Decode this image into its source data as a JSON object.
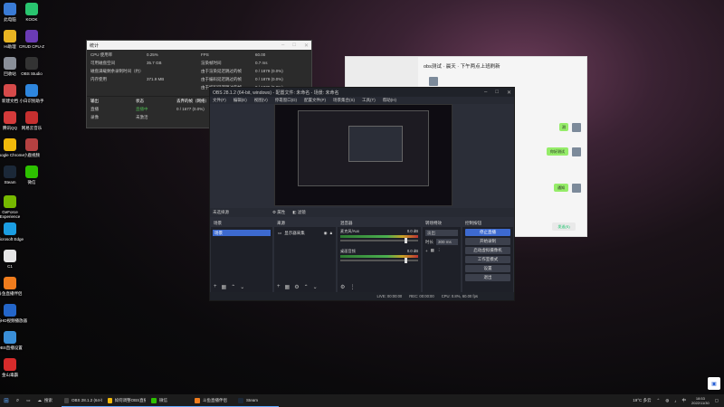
{
  "desktop": {
    "icons": [
      {
        "label": "此电脑",
        "color": "#3a7bd5"
      },
      {
        "label": "KOOK",
        "color": "#29c46f"
      },
      {
        "label": "Hi助理",
        "color": "#e8b422"
      },
      {
        "label": "CRUD CPU-Z",
        "color": "#6a3bb5"
      },
      {
        "label": "回收站",
        "color": "#8a8f99"
      },
      {
        "label": "OBS Studio",
        "color": "#333333"
      },
      {
        "label": "新建文档",
        "color": "#d64a4a"
      },
      {
        "label": "小白识别助手",
        "color": "#2e86de"
      },
      {
        "label": "腾讯QQ",
        "color": "#d43b3b"
      },
      {
        "label": "网易云音乐",
        "color": "#c62f2f"
      },
      {
        "label": "Google Chrome",
        "color": "#f0b90b"
      },
      {
        "label": "小鹿视频",
        "color": "#b44141"
      },
      {
        "label": "Steam",
        "color": "#1b2838"
      },
      {
        "label": "微信",
        "color": "#2dc100"
      },
      {
        "label": "GeForce Experience",
        "color": "#76b900"
      },
      {
        "label": "Microsoft Edge",
        "color": "#1b9de2"
      },
      {
        "label": "C1",
        "color": "#e6e6e6"
      },
      {
        "label": "斗鱼直播伴侣",
        "color": "#f07c1d"
      },
      {
        "label": "网络HD视频播放器",
        "color": "#2466c9"
      },
      {
        "label": "OBS直播设置",
        "color": "#3a8fd8"
      },
      {
        "label": "金山毒霸",
        "color": "#d62b2b"
      }
    ]
  },
  "stats_window": {
    "title": "统计",
    "rows": [
      {
        "k": "CPU 使用率",
        "v": "0.25%",
        "k2": "FPS",
        "v2": "60.00"
      },
      {
        "k": "可用磁盘空间",
        "v": "35.7 GB",
        "k2": "渲染帧时间",
        "v2": "0.7 ms"
      },
      {
        "k": "磁盘满载剩余录制时间（约）",
        "v": "",
        "k2": "由于渲染延迟跳过的帧",
        "v2": "0 / 1879 (0.0%)"
      },
      {
        "k": "内存使用",
        "v": "371.9 MB",
        "k2": "由于编码延迟跳过的帧",
        "v2": "0 / 1879 (0.0%)"
      },
      {
        "k": "",
        "v": "",
        "k2": "由于编码延迟跳过的帧",
        "v2": "0 / 1879 (0.0%)"
      }
    ],
    "out_headers": [
      "输出",
      "状态",
      "丢弃的帧（网络）",
      "总数据输出"
    ],
    "out_rows": [
      [
        "直播",
        "直播中",
        "0 / 1677 (0.0%)",
        ""
      ],
      [
        "录像",
        "未激活",
        "",
        ""
      ]
    ]
  },
  "chat_window": {
    "title": "obs测试 · 晨天 · 下午两点上班刷新",
    "messages": [
      "测",
      "你好测试",
      "通知"
    ],
    "send_label": "发送(S)"
  },
  "obs_window": {
    "title": "OBS 28.1.2 (64-bit, windows) - 配置文件: 未命名 - 场景: 未命名",
    "menus": [
      "文件(F)",
      "编辑(E)",
      "视图(V)",
      "停靠窗口(D)",
      "配置文件(P)",
      "场景集合(S)",
      "工具(T)",
      "帮助(H)"
    ],
    "source_bar": {
      "label": "未选择源",
      "props": "属性",
      "filters": "滤镜"
    },
    "docks": {
      "scenes": {
        "title": "场景",
        "items": [
          "场景"
        ]
      },
      "sources": {
        "title": "来源",
        "items": [
          "显示器采集"
        ]
      },
      "mixer": {
        "title": "混音器",
        "channels": [
          {
            "name": "麦克风/Aux",
            "db": "0.0 dB"
          },
          {
            "name": "桌面音频",
            "db": "0.0 dB"
          }
        ]
      },
      "transitions": {
        "title": "转场特效",
        "type": "淡出",
        "duration_label": "时长",
        "duration": "300 ms"
      },
      "controls": {
        "title": "控制按钮",
        "buttons": [
          "停止直播",
          "开始录制",
          "启动虚拟摄像机",
          "工作室模式",
          "设置",
          "退出"
        ]
      }
    },
    "status": {
      "live": "LIVE: 00:00:00",
      "rec": "REC: 00:00:00",
      "cpu": "CPU: 0.8%, 60.00 fps"
    }
  },
  "taskbar": {
    "apps": [
      {
        "label": "OBS 28.1.2 (64-bit...",
        "color": "#444444"
      },
      {
        "label": "如何调整OBS直播设...",
        "color": "#f0b90b"
      },
      {
        "label": "微信",
        "color": "#2dc100"
      },
      {
        "label": "斗鱼直播伴侣",
        "color": "#f07c1d"
      },
      {
        "label": "Steam",
        "color": "#1b2838"
      }
    ],
    "search_label": "搜索",
    "weather": "19°C 多云",
    "time": "18:53",
    "date": "2022/11/30",
    "lang": "中"
  }
}
